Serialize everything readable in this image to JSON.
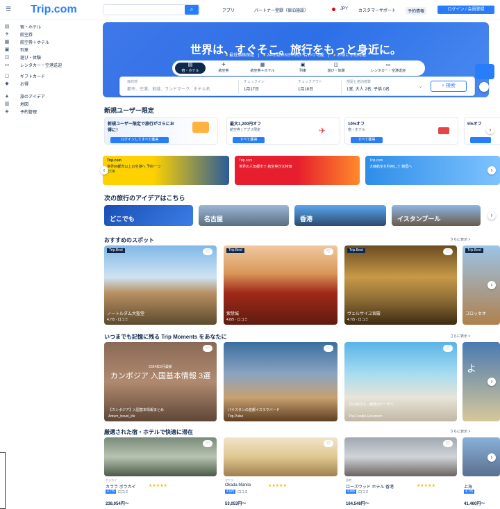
{
  "header": {
    "logo": "Trip.com",
    "links": [
      "アプリ",
      "パートナー登録（宿泊施設）",
      "JPY",
      "カスタマーサポート",
      "予約情報"
    ],
    "signin": "ログイン / 会員登録"
  },
  "sidebar": {
    "items": [
      {
        "label": "宿・ホテル",
        "icon": "hotel-icon"
      },
      {
        "label": "航空券",
        "icon": "plane-icon"
      },
      {
        "label": "航空券＋ホテル",
        "icon": "plane-hotel-icon"
      },
      {
        "label": "列車",
        "icon": "train-icon"
      },
      {
        "label": "遊び・体験",
        "icon": "ticket-icon"
      },
      {
        "label": "レンタカー・空港送迎",
        "icon": "car-icon"
      },
      {
        "label": "ギフトカード",
        "icon": "gift-icon"
      },
      {
        "label": "お得",
        "icon": "tag-icon"
      },
      {
        "label": "旅のアイデア",
        "icon": "bulb-icon"
      },
      {
        "label": "地図",
        "icon": "map-icon"
      },
      {
        "label": "予約管理",
        "icon": "list-icon"
      }
    ]
  },
  "hero": {
    "title": "世界は、すぐそこ。旅行をもっと身近に。",
    "features": [
      "最低価格保証",
      "24時間365日お問い合わせ可能",
      "お得に予約可能"
    ],
    "tabs": [
      {
        "label": "宿・ホテル",
        "icon": "hotel-icon",
        "active": true
      },
      {
        "label": "航空券",
        "icon": "plane-icon",
        "active": false
      },
      {
        "label": "航空券＋ホテル",
        "icon": "plane-hotel-icon",
        "active": false
      },
      {
        "label": "列車",
        "icon": "train-icon",
        "active": false
      },
      {
        "label": "遊び・体験",
        "icon": "ticket-icon",
        "active": false
      },
      {
        "label": "レンタカー・空港送迎",
        "icon": "car-icon",
        "active": false
      }
    ]
  },
  "search_form": {
    "dest_label": "目的地",
    "dest_value": "都市、空港、地域、ランドマーク、ホテル名",
    "checkin_label": "チェックイン",
    "checkin_value": "1月17日",
    "checkout_label": "チェックアウト",
    "checkout_value": "1月18日",
    "guests_label": "部屋と宿泊者数",
    "guests_value": "1室, 大人 2名, 子供 0名",
    "search_button": "検索"
  },
  "new_user": {
    "heading": "新規ユーザー限定",
    "promos": [
      {
        "title": "新規ユーザー限定で旅行がさらにお得に！",
        "sub": "",
        "button": "ログインしてすべて獲得"
      },
      {
        "title": "最大1,200円オフ",
        "sub": "航空券 | アプリ限定",
        "button": "すべて獲得"
      },
      {
        "title": "10%オフ",
        "sub": "宿・ホテル",
        "button": "すべて獲得"
      },
      {
        "title": "5%オフ",
        "sub": "",
        "button": ""
      }
    ]
  },
  "banners": [
    {
      "brand": "Trip.com",
      "text": "世界80都市以上の空港へ 予約一つでOK"
    },
    {
      "brand": "Trip.com",
      "text": "世界の人気都市で 航空券が大特価"
    },
    {
      "brand": "Trip.com",
      "text": "大韓航空を利用して 韓国へ"
    }
  ],
  "ideas": {
    "heading": "次の旅行のアイデアはこちら",
    "items": [
      "どこでも",
      "名古屋",
      "香港",
      "イスタンブール"
    ]
  },
  "spots": {
    "heading": "おすすめのスポット",
    "more": "さらに表示 >",
    "cards": [
      {
        "tag": "Trip.Best",
        "name": "ノートルダム大聖堂",
        "rating": "4.7/5 · 口コミ"
      },
      {
        "tag": "Trip.Best",
        "name": "紫禁城",
        "rating": "4.8/5 · 口コミ"
      },
      {
        "tag": "Trip.Best",
        "name": "ヴェルサイユ宮殿",
        "rating": "4.7/5 · 口コミ"
      },
      {
        "tag": "Trip.Best",
        "name": "コロッセオ",
        "rating": ""
      }
    ]
  },
  "moments": {
    "heading": "いつまでも記憶に残る Trip Moments をあなたに",
    "more": "さらに表示 >",
    "cards": [
      {
        "overlay": "カンボジア 入国基本情報 3選",
        "date": "2024年9月最新",
        "title": "【カンボジア】入国基本情報まとめ",
        "author": "Antum_travel_life"
      },
      {
        "overlay": "",
        "date": "",
        "title": "パキスタンの首都イスラマバード",
        "author": "Trip.Pulse"
      },
      {
        "overlay": "",
        "date": "",
        "title": "次の旅行は…絶景のビーチへ",
        "author": "The Foodie Excursion"
      },
      {
        "overlay": "よ",
        "date": "",
        "title": "",
        "author": ""
      }
    ]
  },
  "hotels": {
    "heading": "厳選された宿・ホテルで快適に滞在",
    "more": "さらに表示 >",
    "cards": [
      {
        "area": "ボラカイ",
        "name": "カララ ボラカイ",
        "score": "4.7/5",
        "reviews": "口コミ",
        "price": "238,054円〜"
      },
      {
        "area": "マニラ",
        "name": "Okada Manila",
        "score": "4.6/5",
        "reviews": "口コミ",
        "price": "53,053円〜"
      },
      {
        "area": "香港",
        "name": "ローズウッド ホテル 香港",
        "score": "4.8/5",
        "reviews": "口コミ",
        "price": "164,548円〜"
      },
      {
        "area": "上海",
        "name": "上海",
        "score": "4.7/5",
        "reviews": "",
        "price": "41,460円〜"
      }
    ]
  },
  "colors": {
    "brand": "#287dfa",
    "navy": "#0f294d"
  }
}
